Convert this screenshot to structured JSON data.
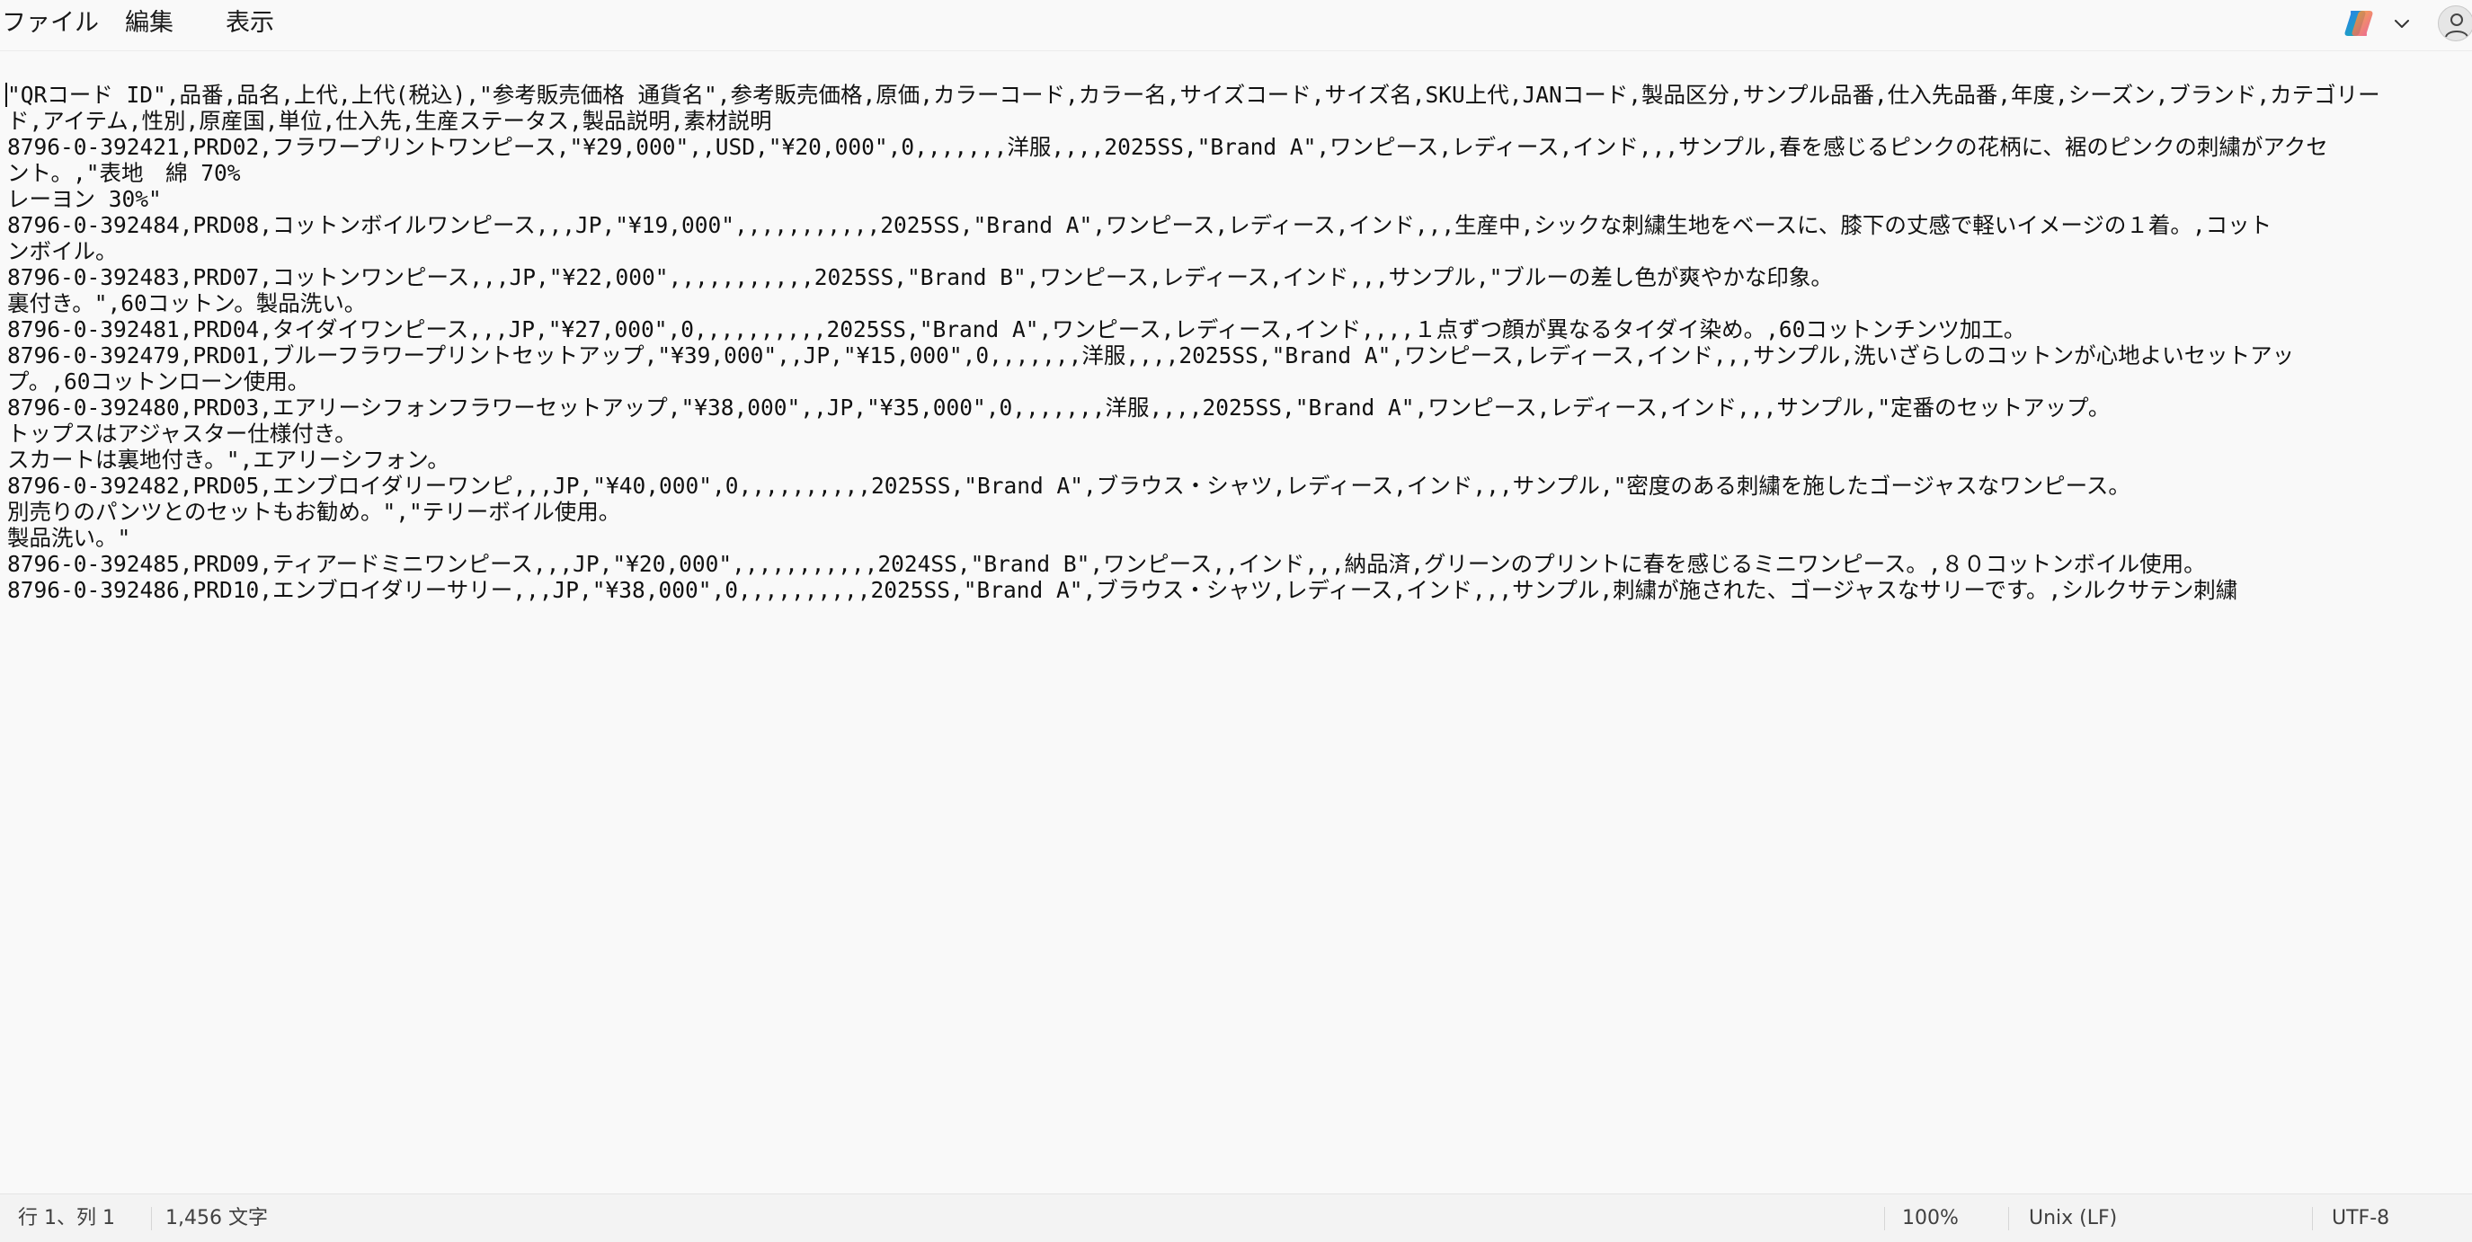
{
  "menu": {
    "file": "ファイル",
    "edit": "編集",
    "view": "表示"
  },
  "toolbar_icons": [
    "copilot-icon",
    "chevron-down-icon",
    "account-icon"
  ],
  "editor": {
    "lines": [
      "\"QRコード ID\",品番,品名,上代,上代(税込),\"参考販売価格 通貨名\",参考販売価格,原価,カラーコード,カラー名,サイズコード,サイズ名,SKU上代,JANコード,製品区分,サンプル品番,仕入先品番,年度,シーズン,ブランド,カテゴリー",
      "ド,アイテム,性別,原産国,単位,仕入先,生産ステータス,製品説明,素材説明",
      "8796-0-392421,PRD02,フラワープリントワンピース,\"¥29,000\",,USD,\"¥20,000\",0,,,,,,,洋服,,,,2025SS,\"Brand A\",ワンピース,レディース,インド,,,サンプル,春を感じるピンクの花柄に、裾のピンクの刺繍がアクセ",
      "ント。,\"表地　綿 70%",
      "レーヨン 30%\"",
      "8796-0-392484,PRD08,コットンボイルワンピース,,,JP,\"¥19,000\",,,,,,,,,,,2025SS,\"Brand A\",ワンピース,レディース,インド,,,生産中,シックな刺繍生地をベースに、膝下の丈感で軽いイメージの１着。,コット",
      "ンボイル。",
      "8796-0-392483,PRD07,コットンワンピース,,,JP,\"¥22,000\",,,,,,,,,,,2025SS,\"Brand B\",ワンピース,レディース,インド,,,サンプル,\"ブルーの差し色が爽やかな印象。",
      "裏付き。\",60コットン。製品洗い。",
      "8796-0-392481,PRD04,タイダイワンピース,,,JP,\"¥27,000\",0,,,,,,,,,,2025SS,\"Brand A\",ワンピース,レディース,インド,,,,１点ずつ顔が異なるタイダイ染め。,60コットンチンツ加工。",
      "8796-0-392479,PRD01,ブルーフラワープリントセットアップ,\"¥39,000\",,JP,\"¥15,000\",0,,,,,,,洋服,,,,2025SS,\"Brand A\",ワンピース,レディース,インド,,,サンプル,洗いざらしのコットンが心地よいセットアッ",
      "プ。,60コットンローン使用。",
      "8796-0-392480,PRD03,エアリーシフォンフラワーセットアップ,\"¥38,000\",,JP,\"¥35,000\",0,,,,,,,洋服,,,,2025SS,\"Brand A\",ワンピース,レディース,インド,,,サンプル,\"定番のセットアップ。",
      "トップスはアジャスター仕様付き。",
      "スカートは裏地付き。\",エアリーシフォン。",
      "8796-0-392482,PRD05,エンブロイダリーワンピ,,,JP,\"¥40,000\",0,,,,,,,,,,2025SS,\"Brand A\",ブラウス・シャツ,レディース,インド,,,サンプル,\"密度のある刺繍を施したゴージャスなワンピース。",
      "別売りのパンツとのセットもお勧め。\",\"テリーボイル使用。",
      "製品洗い。\"",
      "8796-0-392485,PRD09,ティアードミニワンピース,,,JP,\"¥20,000\",,,,,,,,,,,2024SS,\"Brand B\",ワンピース,,インド,,,納品済,グリーンのプリントに春を感じるミニワンピース。,８０コットンボイル使用。",
      "8796-0-392486,PRD10,エンブロイダリーサリー,,,JP,\"¥38,000\",0,,,,,,,,,,2025SS,\"Brand A\",ブラウス・シャツ,レディース,インド,,,サンプル,刺繍が施された、ゴージャスなサリーです。,シルクサテン刺繍"
    ]
  },
  "status": {
    "position": "行 1、列 1",
    "char_count": "1,456 文字",
    "zoom": "100%",
    "line_ending": "Unix (LF)",
    "encoding": "UTF-8"
  }
}
